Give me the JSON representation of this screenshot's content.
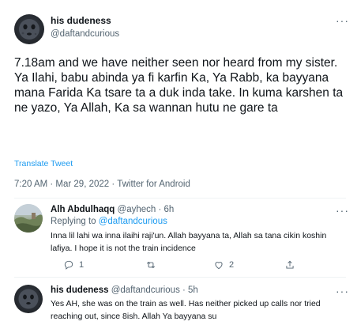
{
  "main_tweet": {
    "author_name": "his dudeness",
    "author_handle": "@daftandcurious",
    "more_label": "···",
    "paragraphs": [
      "7.18am and we have neither seen nor heard from my sister.",
      "Ya Ilahi, babu abinda ya fi karfin Ka, Ya Rabb, ka bayyana mana Farida Ka tsare ta a duk inda take. In kuma karshen ta ne yazo, Ya Allah, Ka sa wannan hutu ne gare ta"
    ],
    "translate_label": "Translate Tweet",
    "meta": "7:20 AM · Mar 29, 2022 · Twitter for Android"
  },
  "replies": [
    {
      "author_name": "Alh Abdulhaqq",
      "author_handle": "@ayhech · 6h",
      "replying_prefix": "Replying to ",
      "replying_to": "@daftandcurious",
      "text": "Inna lil lahi wa inna ilaihi raji'un. Allah bayyana ta, Allah sa tana cikin koshin lafiya. I hope it is not the train incidence",
      "reply_count": "1",
      "retweet_count": "",
      "like_count": "2",
      "more_label": "···"
    },
    {
      "author_name": "his dudeness",
      "author_handle": "@daftandcurious · 5h",
      "text": "Yes AH, she was on the train as well. Has neither picked up calls nor tried reaching out, since 8ish. Allah Ya bayyana su",
      "more_label": "···"
    }
  ],
  "icons": {
    "reply": "reply-icon",
    "retweet": "retweet-icon",
    "like": "heart-icon",
    "share": "share-icon",
    "more": "more-icon"
  },
  "colors": {
    "link": "#1d9bf0",
    "secondary_text": "#536471",
    "divider": "#eff3f4"
  }
}
